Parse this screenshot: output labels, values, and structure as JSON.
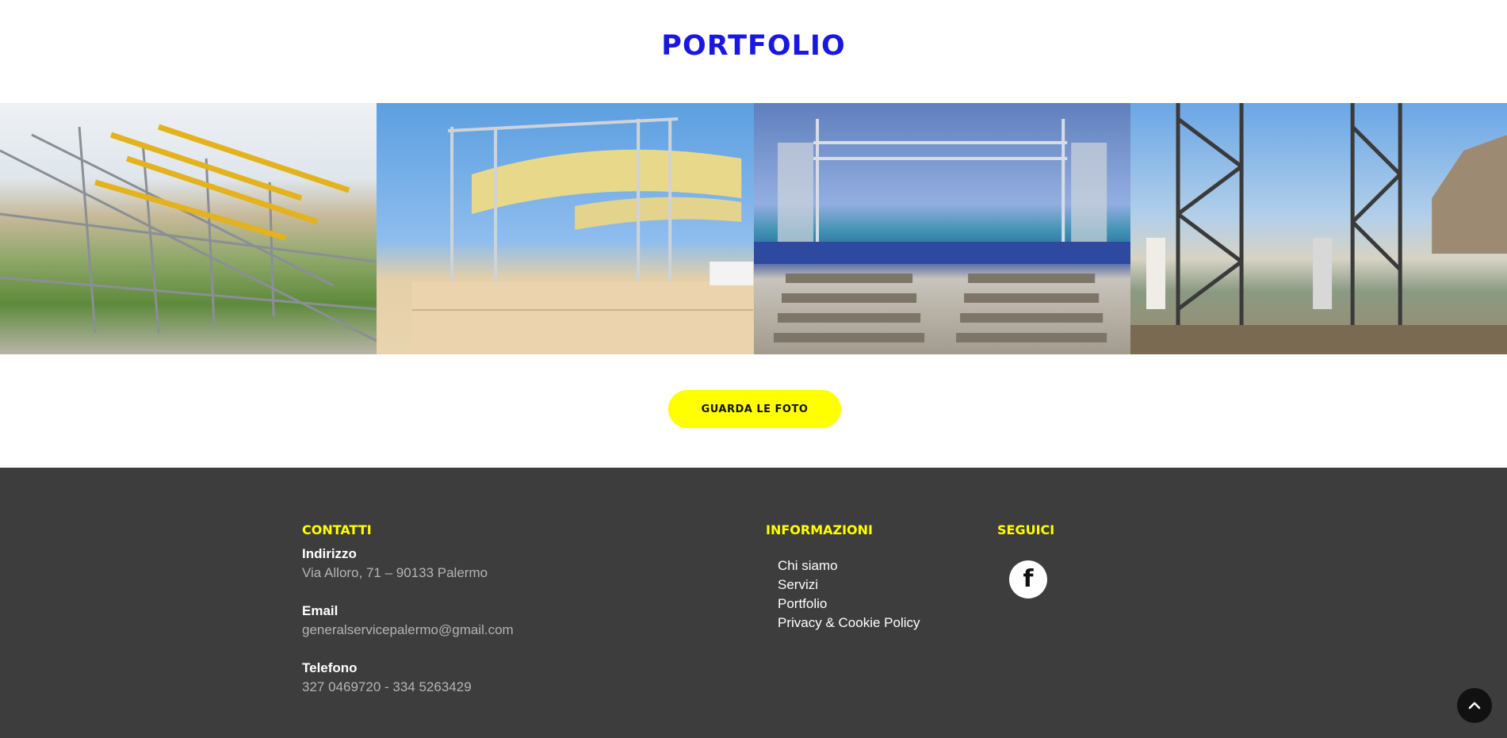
{
  "portfolio": {
    "title": "PORTFOLIO",
    "photos": [
      {
        "name": "scaffolding-grandstand-photo"
      },
      {
        "name": "stage-construction-photo"
      },
      {
        "name": "beach-stage-photo"
      },
      {
        "name": "truss-workers-photo"
      }
    ],
    "cta_label": "GUARDA LE FOTO"
  },
  "footer": {
    "contatti": {
      "heading": "CONTATTI",
      "address_label": "Indirizzo",
      "address_value": "Via Alloro, 71 – 90133 Palermo",
      "email_label": "Email",
      "email_value": "generalservicepalermo@gmail.com",
      "phone_label": "Telefono",
      "phone_value": "327 0469720 - 334 5263429"
    },
    "informazioni": {
      "heading": "INFORMAZIONI",
      "links": [
        "Chi siamo",
        "Servizi",
        "Portfolio",
        "Privacy & Cookie Policy"
      ]
    },
    "seguici": {
      "heading": "SEGUICI",
      "icon": "facebook-icon",
      "icon_glyph": "f"
    }
  },
  "colors": {
    "title": "#1a17e0",
    "cta_bg": "#ffff00",
    "footer_bg": "#3d3d3d",
    "footer_heading": "#ffff00"
  },
  "back_to_top_icon": "chevron-up-icon"
}
